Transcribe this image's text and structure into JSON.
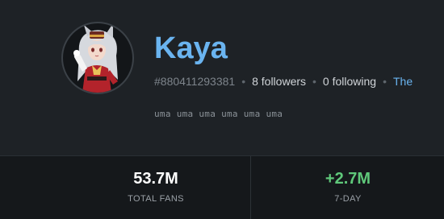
{
  "profile": {
    "username": "Kaya",
    "user_id": "#880411293381",
    "followers": "8 followers",
    "following": "0 following",
    "extra_link": "The",
    "bio": "uma uma uma uma uma uma",
    "avatar_icon": "anime-character-avatar"
  },
  "stats": {
    "total_fans": {
      "value": "53.7M",
      "label": "TOTAL FANS"
    },
    "seven_day": {
      "value": "+2.7M",
      "label": "7-DAY"
    }
  },
  "colors": {
    "background": "#1e2226",
    "stats_background": "#15181b",
    "accent": "#6ab4f0",
    "positive": "#5fc87a"
  }
}
